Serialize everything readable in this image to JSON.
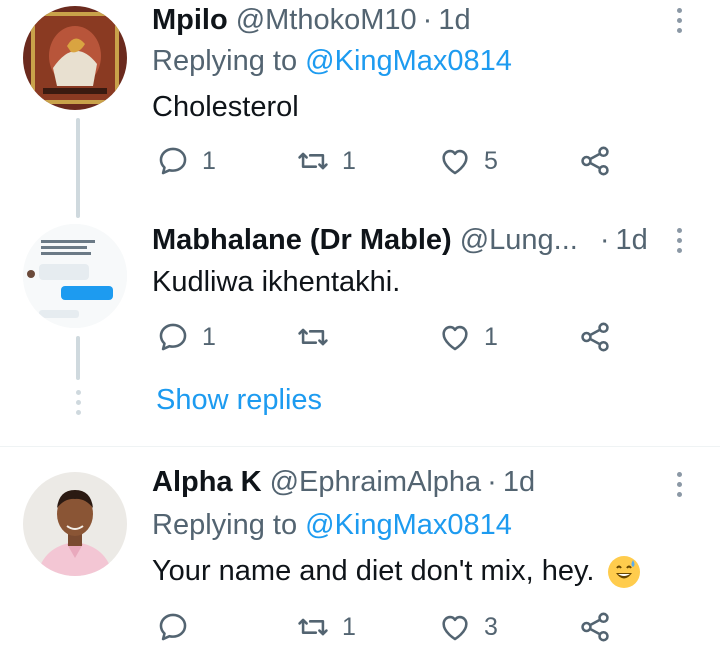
{
  "tweets": [
    {
      "name": "Mpilo",
      "handle": "@MthokoM10",
      "time": "1d",
      "replying_label": "Replying to",
      "replying_to": "@KingMax0814",
      "text": "Cholesterol",
      "replies": "1",
      "retweets": "1",
      "likes": "5"
    },
    {
      "name": "Mabhalane (Dr Mable)",
      "handle": "@Lung...",
      "time": "1d",
      "text": "Kudliwa ikhentakhi.",
      "replies": "1",
      "retweets": "",
      "likes": "1",
      "show_replies": "Show replies"
    },
    {
      "name": "Alpha K",
      "handle": "@EphraimAlpha",
      "time": "1d",
      "replying_label": "Replying to",
      "replying_to": "@KingMax0814",
      "text": "Your name and diet don't mix, hey.",
      "replies": "",
      "retweets": "1",
      "likes": "3"
    }
  ],
  "separator": "·",
  "colors": {
    "accent": "#1d9bf0",
    "muted": "#536471",
    "text": "#0f1419"
  }
}
